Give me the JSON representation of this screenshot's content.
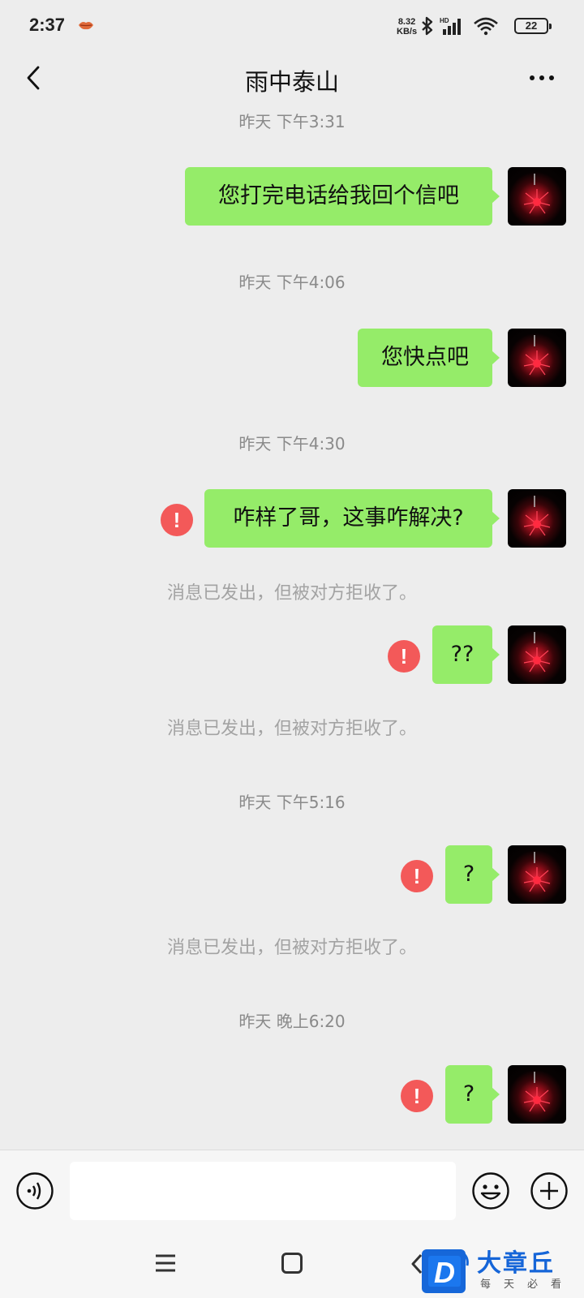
{
  "status_bar": {
    "time": "2:37",
    "net_speed_value": "8.32",
    "net_speed_unit": "KB/s",
    "signal_label": "HD",
    "battery": "22"
  },
  "header": {
    "title": "雨中泰山",
    "back_icon": "chevron-left-icon",
    "more_icon": "more-dots-icon"
  },
  "messages": [
    {
      "time": "昨天 下午3:31",
      "text": "您打完电话给我回个信吧",
      "failed": false
    },
    {
      "time": "昨天 下午4:06",
      "text": "您快点吧",
      "failed": false
    },
    {
      "time": "昨天 下午4:30",
      "text": "咋样了哥，这事咋解决?",
      "failed": true,
      "notice": "消息已发出，但被对方拒收了。"
    },
    {
      "text": "??",
      "failed": true,
      "notice": "消息已发出，但被对方拒收了。"
    },
    {
      "time": "昨天 下午5:16",
      "text": "?",
      "failed": true,
      "notice": "消息已发出，但被对方拒收了。"
    },
    {
      "time": "昨天 晚上6:20",
      "text": "?",
      "failed": true
    }
  ],
  "error_mark": "!",
  "input_bar": {
    "voice_icon": "voice-icon",
    "emoji_icon": "emoji-icon",
    "plus_icon": "plus-icon",
    "value": ""
  },
  "watermark": {
    "title": "大章丘",
    "subtitle": "每天必看",
    "logo_letter": "D"
  },
  "colors": {
    "bubble": "#95ec69",
    "error": "#f35959",
    "background": "#ededed"
  }
}
